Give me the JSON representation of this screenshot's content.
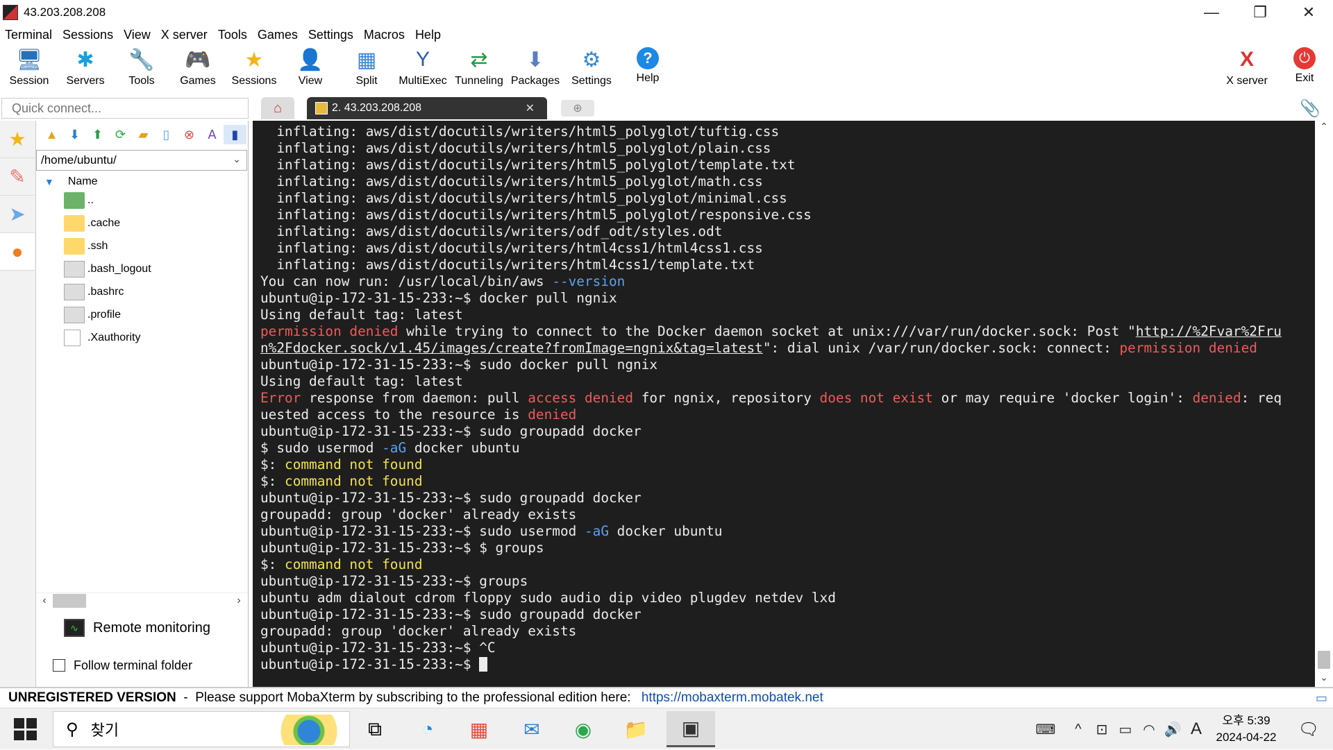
{
  "window": {
    "title": "43.203.208.208",
    "minimize": "—",
    "restore": "❐",
    "close": "✕"
  },
  "menu": [
    "Terminal",
    "Sessions",
    "View",
    "X server",
    "Tools",
    "Games",
    "Settings",
    "Macros",
    "Help"
  ],
  "toolbar": [
    {
      "label": "Session",
      "icon": "session-icon",
      "glyph": "🖥",
      "color": "#2a6fb8"
    },
    {
      "label": "Servers",
      "icon": "servers-icon",
      "glyph": "✱",
      "color": "#1aa0d8"
    },
    {
      "label": "Tools",
      "icon": "tools-icon",
      "glyph": "🔧",
      "color": "#d33"
    },
    {
      "label": "Games",
      "icon": "games-icon",
      "glyph": "🎮",
      "color": "#555"
    },
    {
      "label": "Sessions",
      "icon": "star-icon",
      "glyph": "★",
      "color": "#f2b619"
    },
    {
      "label": "View",
      "icon": "view-icon",
      "glyph": "👤",
      "color": "#3b6fb0"
    },
    {
      "label": "Split",
      "icon": "split-icon",
      "glyph": "▦",
      "color": "#3a86d1"
    },
    {
      "label": "MultiExec",
      "icon": "multiexec-icon",
      "glyph": "Y",
      "color": "#2b5fb0"
    },
    {
      "label": "Tunneling",
      "icon": "tunneling-icon",
      "glyph": "⇄",
      "color": "#2a9a4a"
    },
    {
      "label": "Packages",
      "icon": "packages-icon",
      "glyph": "⬇",
      "color": "#5a7fc0"
    },
    {
      "label": "Settings",
      "icon": "gear-icon",
      "glyph": "⚙",
      "color": "#3a86d1"
    },
    {
      "label": "Help",
      "icon": "help-icon",
      "glyph": "?",
      "color": "#fff"
    },
    {
      "label": "X server",
      "icon": "xserver-icon",
      "glyph": "X",
      "color": "#d33"
    },
    {
      "label": "Exit",
      "icon": "power-icon",
      "glyph": "⏻",
      "color": "#fff"
    }
  ],
  "quick_connect": {
    "placeholder": "Quick connect..."
  },
  "tabs": {
    "home_icon": "⌂",
    "session_label": "2. 43.203.208.208",
    "close": "✕",
    "new_tab": "⊕",
    "attach": "📎"
  },
  "sidebar": {
    "path": "/home/ubuntu/",
    "column_header": "Name",
    "files": [
      {
        "name": "..",
        "type": "up"
      },
      {
        "name": ".cache",
        "type": "folder"
      },
      {
        "name": ".ssh",
        "type": "folder"
      },
      {
        "name": ".bash_logout",
        "type": "term"
      },
      {
        "name": ".bashrc",
        "type": "term"
      },
      {
        "name": ".profile",
        "type": "term"
      },
      {
        "name": ".Xauthority",
        "type": "doc"
      }
    ],
    "remote_monitoring": "Remote monitoring",
    "follow_terminal": "Follow terminal folder"
  },
  "terminal": {
    "lines": [
      [
        [
          "  inflating: aws/dist/docutils/writers/html5_polyglot/tuftig.css",
          ""
        ]
      ],
      [
        [
          "  inflating: aws/dist/docutils/writers/html5_polyglot/plain.css",
          ""
        ]
      ],
      [
        [
          "  inflating: aws/dist/docutils/writers/html5_polyglot/template.txt",
          ""
        ]
      ],
      [
        [
          "  inflating: aws/dist/docutils/writers/html5_polyglot/math.css",
          ""
        ]
      ],
      [
        [
          "  inflating: aws/dist/docutils/writers/html5_polyglot/minimal.css",
          ""
        ]
      ],
      [
        [
          "  inflating: aws/dist/docutils/writers/html5_polyglot/responsive.css",
          ""
        ]
      ],
      [
        [
          "  inflating: aws/dist/docutils/writers/odf_odt/styles.odt",
          ""
        ]
      ],
      [
        [
          "  inflating: aws/dist/docutils/writers/html4css1/html4css1.css",
          ""
        ]
      ],
      [
        [
          "  inflating: aws/dist/docutils/writers/html4css1/template.txt",
          ""
        ]
      ],
      [
        [
          "You can now run: /usr/local/bin/aws ",
          ""
        ],
        [
          "--version",
          "blu"
        ]
      ],
      [
        [
          "ubuntu@ip-172-31-15-233:~$ docker pull ngnix",
          ""
        ]
      ],
      [
        [
          "Using default tag: latest",
          ""
        ]
      ],
      [
        [
          "permission denied",
          "red"
        ],
        [
          " while trying to connect to the Docker daemon socket at unix:///var/run/docker.sock: Post \"",
          ""
        ],
        [
          "http://%2Fvar%2Fru",
          "link"
        ]
      ],
      [
        [
          "n%2Fdocker.sock/v1.45/images/create?fromImage=ngnix&tag=latest",
          "link"
        ],
        [
          "\": dial unix /var/run/docker.sock: connect: ",
          ""
        ],
        [
          "permission denied",
          "red"
        ]
      ],
      [
        [
          "ubuntu@ip-172-31-15-233:~$ sudo docker pull ngnix",
          ""
        ]
      ],
      [
        [
          "Using default tag: latest",
          ""
        ]
      ],
      [
        [
          "Error",
          "red"
        ],
        [
          " response from daemon: pull ",
          ""
        ],
        [
          "access denied",
          "red"
        ],
        [
          " for ngnix, repository ",
          ""
        ],
        [
          "does not exist",
          "red"
        ],
        [
          " or may require 'docker login': ",
          ""
        ],
        [
          "denied",
          "red"
        ],
        [
          ": req",
          ""
        ]
      ],
      [
        [
          "uested access to the resource is ",
          ""
        ],
        [
          "denied",
          "red"
        ]
      ],
      [
        [
          "ubuntu@ip-172-31-15-233:~$ sudo groupadd docker",
          ""
        ]
      ],
      [
        [
          "$ sudo usermod ",
          ""
        ],
        [
          "-aG",
          "blu"
        ],
        [
          " docker ubuntu",
          ""
        ]
      ],
      [
        [
          "$: ",
          ""
        ],
        [
          "command not found",
          "yel"
        ]
      ],
      [
        [
          "$: ",
          ""
        ],
        [
          "command not found",
          "yel"
        ]
      ],
      [
        [
          "ubuntu@ip-172-31-15-233:~$ sudo groupadd docker",
          ""
        ]
      ],
      [
        [
          "groupadd: group 'docker' already exists",
          ""
        ]
      ],
      [
        [
          "ubuntu@ip-172-31-15-233:~$ sudo usermod ",
          ""
        ],
        [
          "-aG",
          "blu"
        ],
        [
          " docker ubuntu",
          ""
        ]
      ],
      [
        [
          "ubuntu@ip-172-31-15-233:~$ $ groups",
          ""
        ]
      ],
      [
        [
          "$: ",
          ""
        ],
        [
          "command not found",
          "yel"
        ]
      ],
      [
        [
          "ubuntu@ip-172-31-15-233:~$ groups",
          ""
        ]
      ],
      [
        [
          "ubuntu adm dialout cdrom floppy sudo audio dip video plugdev netdev lxd",
          ""
        ]
      ],
      [
        [
          "ubuntu@ip-172-31-15-233:~$ sudo groupadd docker",
          ""
        ]
      ],
      [
        [
          "groupadd: group 'docker' already exists",
          ""
        ]
      ],
      [
        [
          "ubuntu@ip-172-31-15-233:~$ ^C",
          ""
        ]
      ],
      [
        [
          "ubuntu@ip-172-31-15-233:~$ ",
          ""
        ],
        [
          "",
          "cursor"
        ]
      ]
    ]
  },
  "statusbar": {
    "unregistered": "UNREGISTERED VERSION",
    "message": "  -  Please support MobaXterm by subscribing to the professional edition here: ",
    "link": "https://mobaxterm.mobatek.net"
  },
  "taskbar": {
    "search_text": "찾기",
    "apps": [
      {
        "name": "task-view-icon",
        "glyph": "⧉"
      },
      {
        "name": "edge-icon",
        "glyph": "◔"
      },
      {
        "name": "store-icon",
        "glyph": "▦"
      },
      {
        "name": "mail-icon",
        "glyph": "✉"
      },
      {
        "name": "chrome-icon",
        "glyph": "◉"
      },
      {
        "name": "explorer-icon",
        "glyph": "📁"
      },
      {
        "name": "mobaxterm-icon",
        "glyph": "▣"
      }
    ],
    "tray": [
      "⌨",
      "^",
      "⊡",
      "▭",
      "◠",
      "🔊",
      "A"
    ],
    "time": "오후 5:39",
    "date": "2024-04-22",
    "notifications": "🗨"
  }
}
